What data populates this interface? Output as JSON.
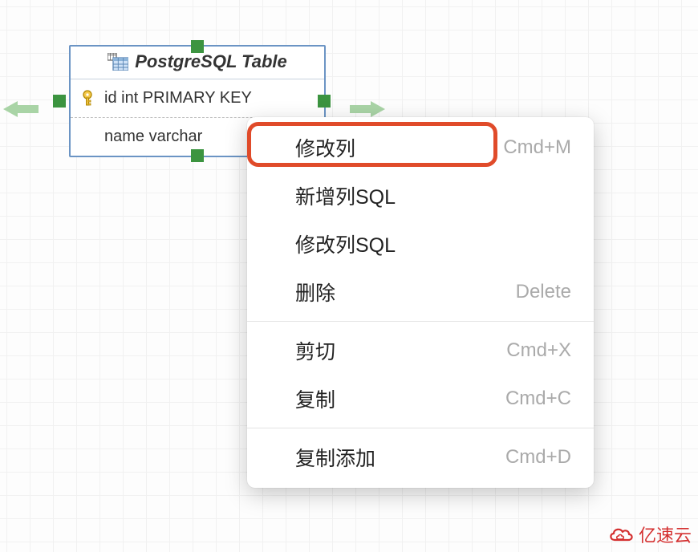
{
  "entity": {
    "title": "PostgreSQL Table",
    "rows": [
      {
        "label": "id int PRIMARY KEY",
        "has_key": true
      },
      {
        "label": "name varchar",
        "has_key": false
      }
    ]
  },
  "context_menu": {
    "groups": [
      [
        {
          "label": "修改列",
          "shortcut": "Cmd+M",
          "highlighted": true
        },
        {
          "label": "新增列SQL",
          "shortcut": ""
        },
        {
          "label": "修改列SQL",
          "shortcut": ""
        },
        {
          "label": "删除",
          "shortcut": "Delete"
        }
      ],
      [
        {
          "label": "剪切",
          "shortcut": "Cmd+X"
        },
        {
          "label": "复制",
          "shortcut": "Cmd+C"
        }
      ],
      [
        {
          "label": "复制添加",
          "shortcut": "Cmd+D"
        }
      ]
    ]
  },
  "watermark": {
    "text": "亿速云"
  },
  "icons": {
    "table": "table-icon",
    "key": "key-icon",
    "arrow_left": "arrow-left-icon",
    "arrow_right": "arrow-right-icon",
    "cloud": "cloud-icon"
  },
  "colors": {
    "handle_green": "#3c9440",
    "arrow_green": "#a9d4a6",
    "entity_border": "#6b94c4",
    "highlight_red": "#e04b2a",
    "brand_red": "#d42f2f"
  }
}
